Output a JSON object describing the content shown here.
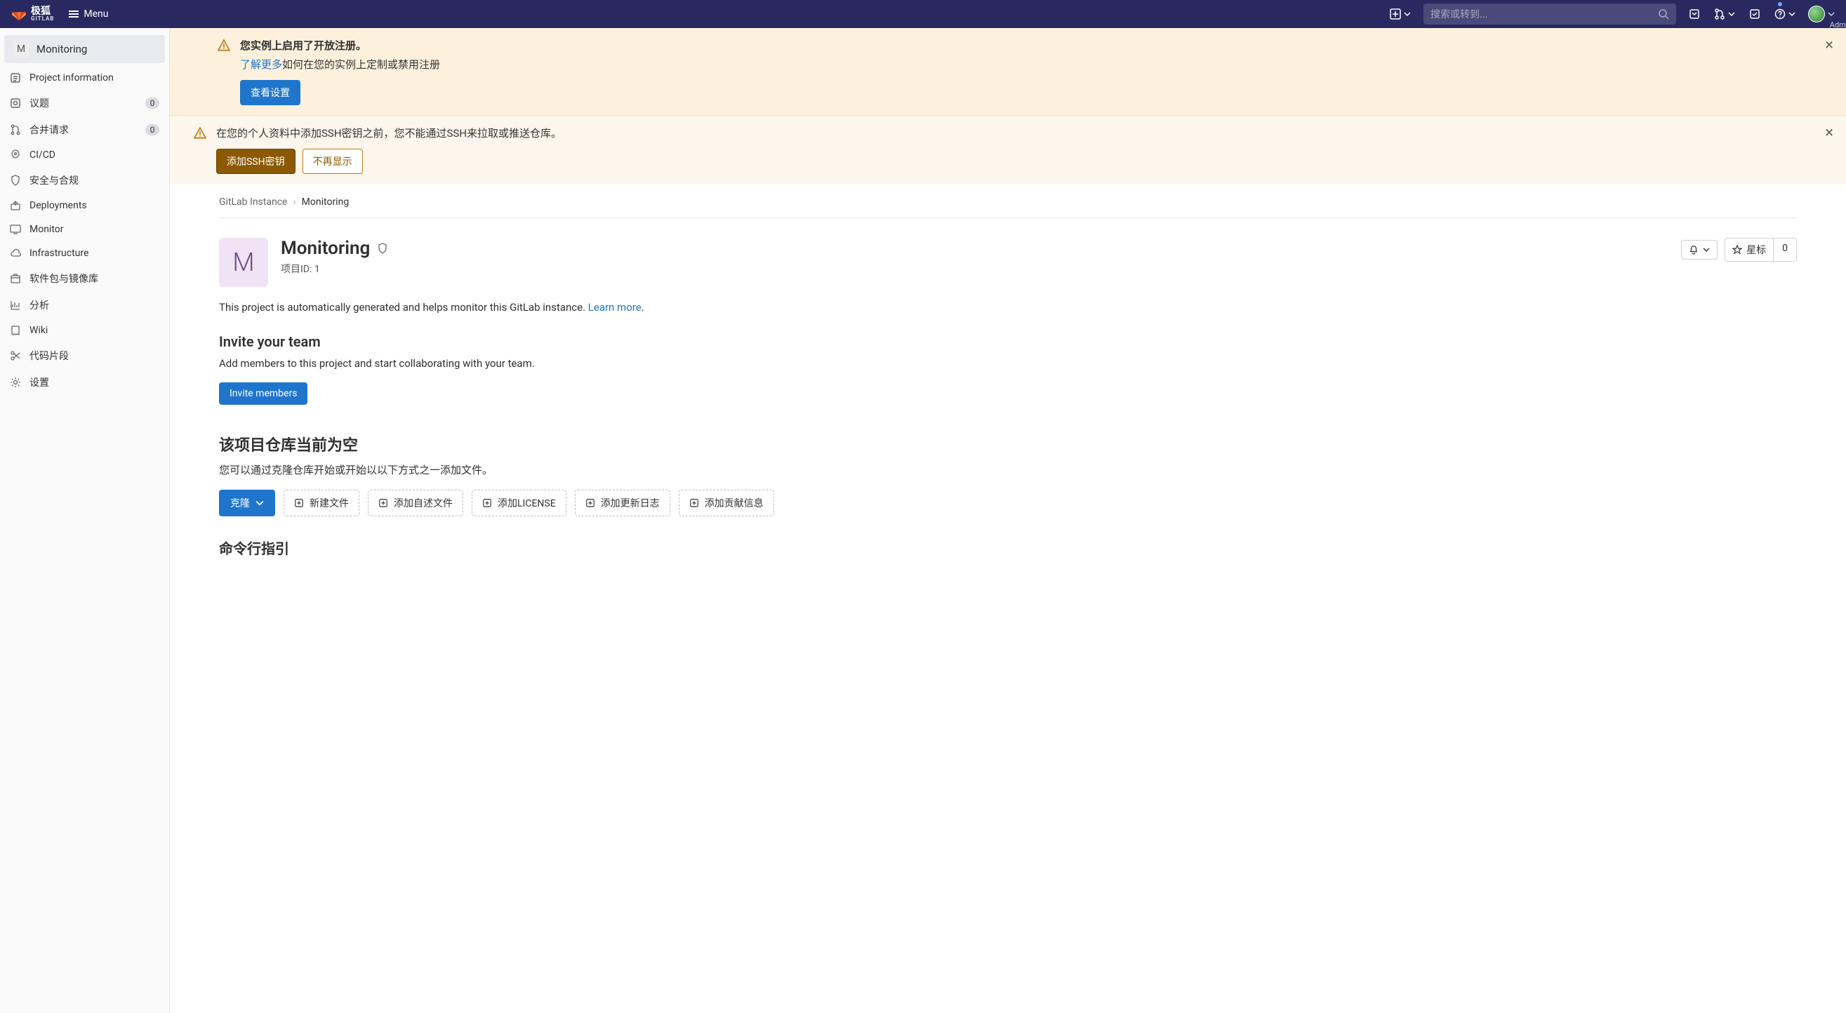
{
  "brand": {
    "name": "极狐",
    "sub": "GITLAB"
  },
  "topbar": {
    "menu": "Menu",
    "search_placeholder": "搜索或转到...",
    "admin_label": "Administra"
  },
  "sidebar": {
    "project_letter": "M",
    "project_name": "Monitoring",
    "items": [
      {
        "icon": "info",
        "label": "Project information"
      },
      {
        "icon": "issue",
        "label": "议题",
        "count": "0"
      },
      {
        "icon": "merge",
        "label": "合并请求",
        "count": "0"
      },
      {
        "icon": "rocket",
        "label": "CI/CD"
      },
      {
        "icon": "shield",
        "label": "安全与合规"
      },
      {
        "icon": "deploy",
        "label": "Deployments"
      },
      {
        "icon": "monitor",
        "label": "Monitor"
      },
      {
        "icon": "cloud",
        "label": "Infrastructure"
      },
      {
        "icon": "package",
        "label": "软件包与镜像库"
      },
      {
        "icon": "chart",
        "label": "分析"
      },
      {
        "icon": "book",
        "label": "Wiki"
      },
      {
        "icon": "scissors",
        "label": "代码片段"
      },
      {
        "icon": "gear",
        "label": "设置"
      }
    ]
  },
  "alerts": {
    "open_reg_title": "您实例上启用了开放注册。",
    "open_reg_link": "了解更多",
    "open_reg_rest": "如何在您的实例上定制或禁用注册",
    "open_reg_action": "查看设置",
    "ssh_text": "在您的个人资料中添加SSH密钥之前，您不能通过SSH来拉取或推送仓库。",
    "ssh_add": "添加SSH密钥",
    "ssh_dismiss": "不再显示"
  },
  "breadcrumb": {
    "root": "GitLab Instance",
    "current": "Monitoring"
  },
  "project": {
    "avatar_letter": "M",
    "name": "Monitoring",
    "id_label": "项目ID: 1",
    "star_label": "星标",
    "star_count": "0",
    "desc_prefix": "This project is automatically generated and helps monitor this GitLab instance. ",
    "desc_link": "Learn more",
    "desc_suffix": "."
  },
  "invite": {
    "heading": "Invite your team",
    "sub": "Add members to this project and start collaborating with your team.",
    "button": "Invite members"
  },
  "empty_repo": {
    "heading": "该项目仓库当前为空",
    "sub": "您可以通过克隆仓库开始或开始以以下方式之一添加文件。",
    "clone": "克隆",
    "actions": [
      "新建文件",
      "添加自述文件",
      "添加LICENSE",
      "添加更新日志",
      "添加贡献信息"
    ],
    "cli_heading": "命令行指引"
  }
}
